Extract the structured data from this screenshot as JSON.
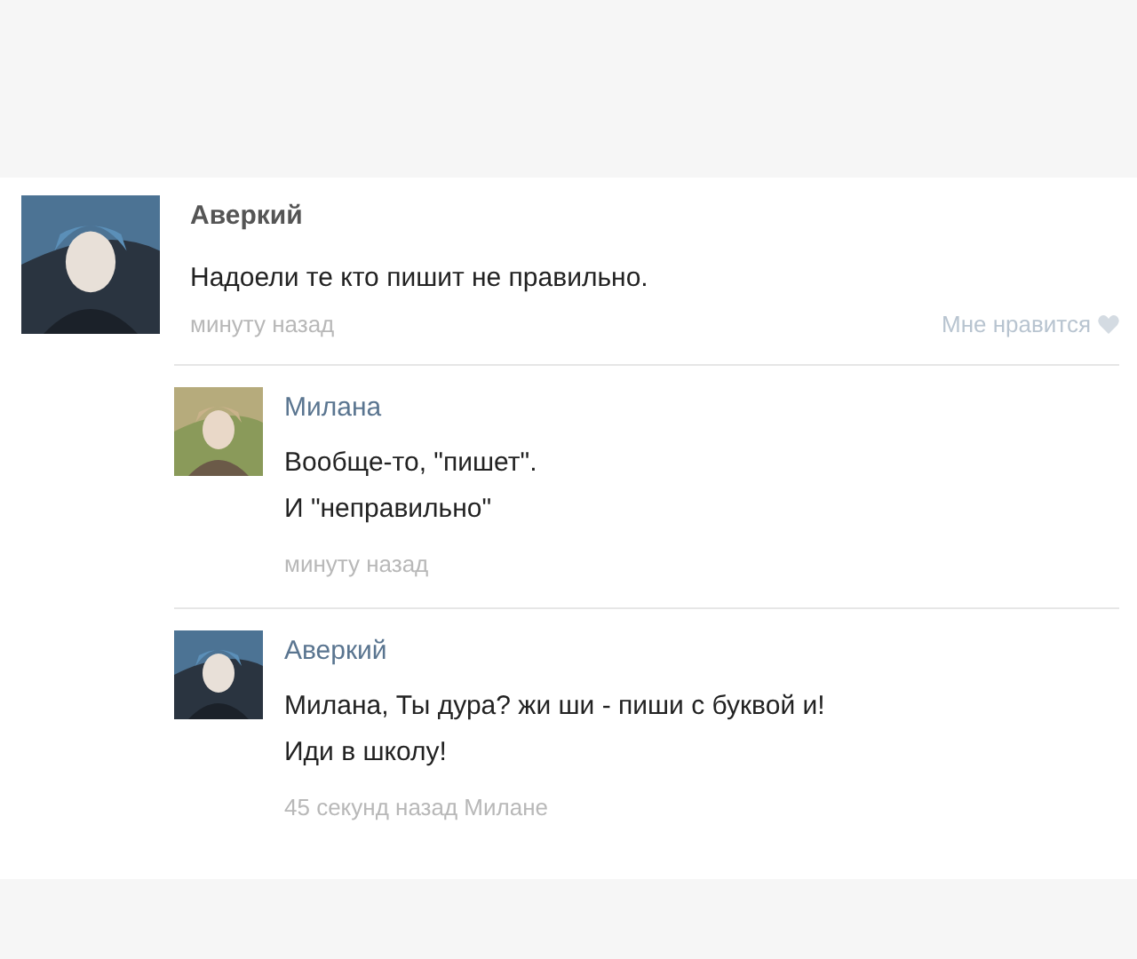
{
  "comments": [
    {
      "author": "Аверкий",
      "lines": [
        "Надоели те кто пишит не правильно."
      ],
      "time": "минуту назад",
      "like_label": "Мне нравится",
      "replies": [
        {
          "author": "Милана",
          "lines": [
            "Вообще-то, \"пишет\".",
            "И \"неправильно\""
          ],
          "time": "минуту назад"
        },
        {
          "author": "Аверкий",
          "lines": [
            "Милана, Ты дура? жи ши - пиши с буквой и!",
            "Иди в школу!"
          ],
          "time": "45 секунд назад Милане"
        }
      ]
    }
  ]
}
